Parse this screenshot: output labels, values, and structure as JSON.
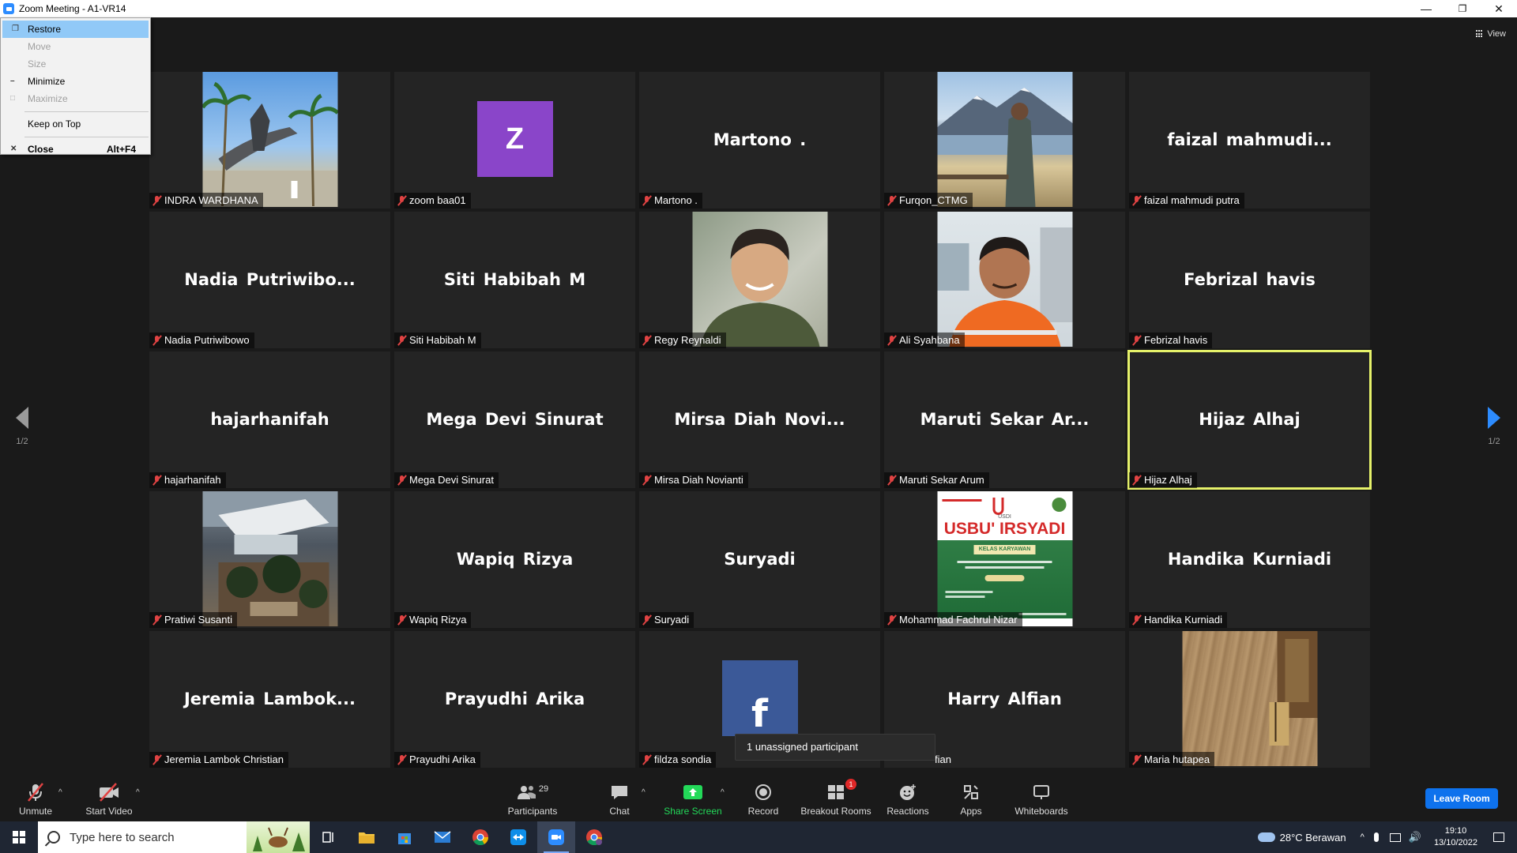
{
  "window": {
    "title": "Zoom Meeting - A1-VR14",
    "minimize": "—",
    "restore": "❐",
    "close": "✕"
  },
  "system_menu": {
    "items": [
      {
        "label": "Restore",
        "state": "highlighted",
        "icon": "restore-icon"
      },
      {
        "label": "Move",
        "state": "disabled"
      },
      {
        "label": "Size",
        "state": "disabled"
      },
      {
        "label": "Minimize",
        "state": "enabled",
        "icon": "minimize-icon"
      },
      {
        "label": "Maximize",
        "state": "disabled",
        "icon": "maximize-icon"
      },
      {
        "label": "Keep on Top",
        "state": "enabled"
      },
      {
        "label": "Close",
        "shortcut": "Alt+F4",
        "state": "enabled",
        "icon": "close-icon"
      }
    ]
  },
  "view_button": {
    "label": "View"
  },
  "pager": {
    "left_label": "1/2",
    "right_label": "1/2"
  },
  "participants": [
    {
      "display": "",
      "label": "INDRA WARDHANA",
      "type": "photo",
      "photo": "beach-statue"
    },
    {
      "display": "Z",
      "label": "zoom baa01",
      "type": "avatar",
      "color": "#8a45c9"
    },
    {
      "display": "Martono .",
      "label": "Martono .",
      "type": "name"
    },
    {
      "display": "",
      "label": "Furqon_CTMG",
      "type": "photo",
      "photo": "mountain-lake"
    },
    {
      "display": "faizal  mahmudi...",
      "label": "faizal mahmudi putra",
      "type": "name"
    },
    {
      "display": "Nadia  Putriwibo...",
      "label": "Nadia Putriwibowo",
      "type": "name"
    },
    {
      "display": "Siti Habibah M",
      "label": "Siti Habibah M",
      "type": "name"
    },
    {
      "display": "",
      "label": "Regy Reynaldi",
      "type": "photo",
      "photo": "portrait-green"
    },
    {
      "display": "",
      "label": "Ali Syahbana",
      "type": "photo",
      "photo": "portrait-orange"
    },
    {
      "display": "Febrizal havis",
      "label": "Febrizal havis",
      "type": "name"
    },
    {
      "display": "hajarhanifah",
      "label": "hajarhanifah",
      "type": "name"
    },
    {
      "display": "Mega Devi Sinurat",
      "label": "Mega Devi Sinurat",
      "type": "name"
    },
    {
      "display": "Mirsa  Diah  Novi...",
      "label": "Mirsa Diah Novianti",
      "type": "name"
    },
    {
      "display": "Maruti  Sekar  Ar...",
      "label": "Maruti Sekar Arum",
      "type": "name"
    },
    {
      "display": "Hijaz Alhaj",
      "label": "Hijaz Alhaj",
      "type": "name",
      "active": true
    },
    {
      "display": "",
      "label": "Pratiwi Susanti",
      "type": "photo",
      "photo": "aerial-pool"
    },
    {
      "display": "Wapiq Rizya",
      "label": "Wapiq Rizya",
      "type": "name"
    },
    {
      "display": "Suryadi",
      "label": "Suryadi",
      "type": "name"
    },
    {
      "display": "",
      "label": "Mohammad Fachrul Nizar",
      "type": "photo",
      "photo": "poster"
    },
    {
      "display": "Handika Kurniadi",
      "label": "Handika Kurniadi",
      "type": "name"
    },
    {
      "display": "Jeremia  Lambok...",
      "label": "Jeremia Lambok Christian",
      "type": "name"
    },
    {
      "display": "Prayudhi Arika",
      "label": "Prayudhi Arika",
      "type": "name"
    },
    {
      "display": "f",
      "label": "fildza sondia",
      "type": "avatar",
      "color": "#3b5998"
    },
    {
      "display": "Harry Alfian",
      "label": "fian",
      "type": "name"
    },
    {
      "display": "",
      "label": "Maria hutapea",
      "type": "photo",
      "photo": "wood-table"
    }
  ],
  "poster_text": {
    "headline": "USBU' IRSYADI",
    "subtitle": "KELAS KARYAWAN",
    "logo": "USDI"
  },
  "tooltip": {
    "text": "1 unassigned participant"
  },
  "toolbar": {
    "unmute": "Unmute",
    "start_video": "Start Video",
    "participants": "Participants",
    "participants_count": "29",
    "chat": "Chat",
    "share_screen": "Share Screen",
    "record": "Record",
    "breakout_rooms": "Breakout Rooms",
    "breakout_badge": "1",
    "reactions": "Reactions",
    "apps": "Apps",
    "whiteboards": "Whiteboards",
    "leave": "Leave Room",
    "caret": "^"
  },
  "taskbar": {
    "search_placeholder": "Type here to search",
    "weather": "28°C  Berawan",
    "time": "19:10",
    "date": "13/10/2022",
    "tray_caret": "^"
  },
  "colors": {
    "accent": "#2d8cff",
    "active_speaker": "#e6f26a",
    "muted": "#e04343",
    "share_green": "#23d959",
    "leave_blue": "#0e72ed"
  }
}
